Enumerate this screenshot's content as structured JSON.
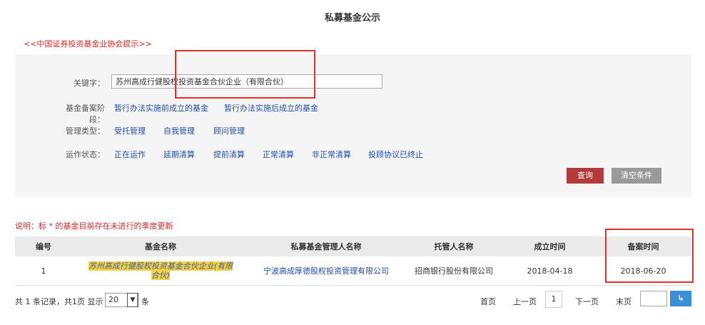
{
  "page": {
    "title": "私募基金公示",
    "hint": "<<中国证券投资基金业协会提示>>"
  },
  "filters": {
    "keyword_label": "关键字：",
    "keyword_value": "苏州高成行健股权投资基金合伙企业（有限合伙）",
    "stage_label": "基金备案阶段：",
    "stage_options": [
      "暂行办法实施前成立的基金",
      "暂行办法实施后成立的基金"
    ],
    "type_label": "管理类型：",
    "type_options": [
      "受托管理",
      "自我管理",
      "顾问管理"
    ],
    "status_label": "运作状态：",
    "status_options": [
      "正在运作",
      "延期清算",
      "提前清算",
      "正常清算",
      "非正常清算",
      "投顾协议已终止"
    ],
    "query_button": "查询",
    "clear_button": "清空条件"
  },
  "note": "说明：标 * 的基金目前存在未进行的季度更新",
  "table": {
    "headers": [
      "编号",
      "基金名称",
      "私募基金管理人名称",
      "托管人名称",
      "成立时间",
      "备案时间"
    ],
    "rows": [
      [
        "1",
        "苏州高成行健股权投资基金合伙企业(有限合伙)",
        "宁波高成厚德股权投资管理有限公司",
        "招商银行股份有限公司",
        "2018-04-18",
        "2018-06-20"
      ]
    ]
  },
  "footer": {
    "summary": "共 1 条记录，共1页  显示",
    "page_size": "20",
    "page_size_suffix": "条",
    "first": "首页",
    "prev": "上一页",
    "current": "1",
    "next": "下一页",
    "last": "末页",
    "go_icon": "enter-arrow-icon"
  },
  "colors": {
    "accent_red": "#e63028",
    "query_red": "#b33a3a",
    "link_blue": "#1f4ea8",
    "highlight": "#f6d23e"
  }
}
